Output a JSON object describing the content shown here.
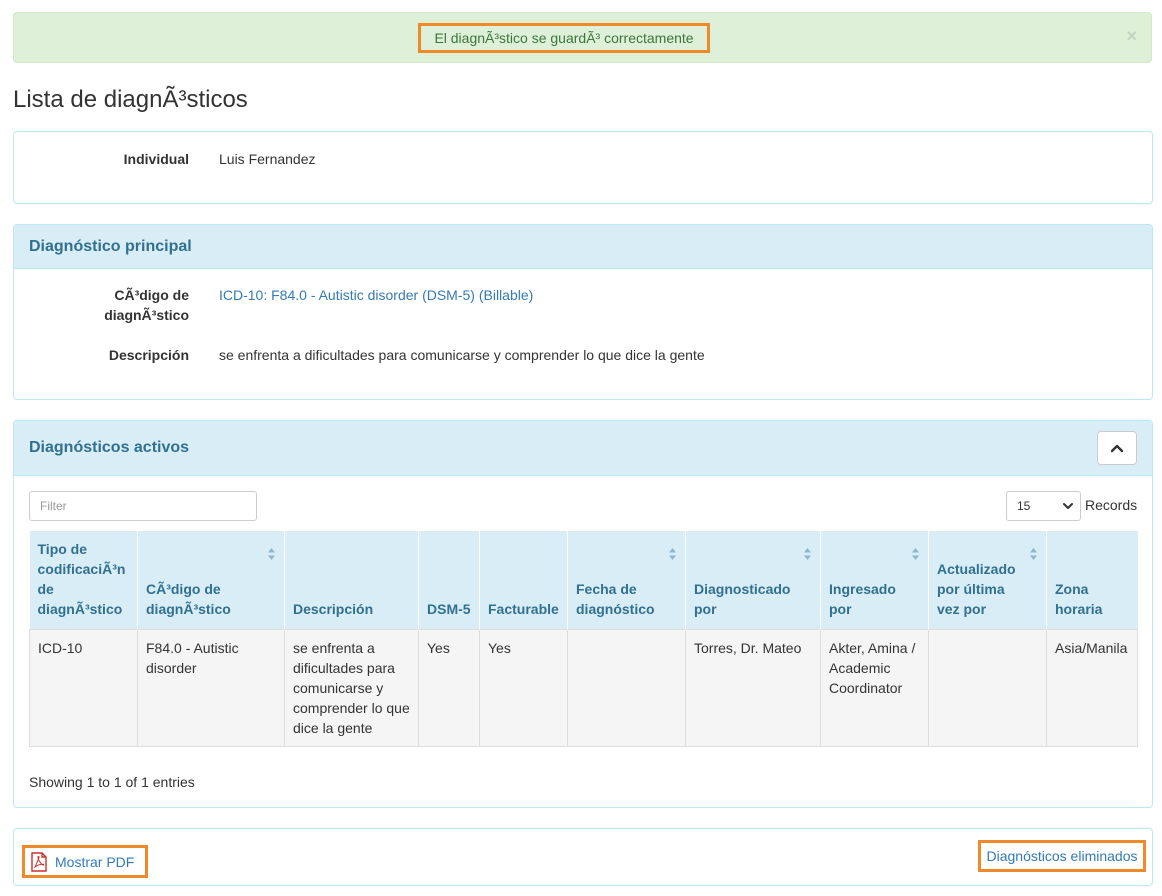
{
  "alert": {
    "message": "El diagnÃ³stico se guardÃ³ correctamente",
    "close_label": "×"
  },
  "page_title": "Lista de diagnÃ³sticos",
  "individual_panel": {
    "label": "Individual",
    "value": "Luis Fernandez"
  },
  "principal_panel": {
    "heading": "Diagnóstico principal",
    "code_label_line1": "CÃ³digo de",
    "code_label_line2": "diagnÃ³stico",
    "code_value": "ICD-10: F84.0 - Autistic disorder (DSM-5) (Billable)",
    "desc_label": "Descripción",
    "desc_value": "se enfrenta a dificultades para comunicarse y comprender lo que dice la gente"
  },
  "active_panel": {
    "heading": "Diagnósticos activos",
    "filter_placeholder": "Filter",
    "records_value": "15",
    "records_label": "Records",
    "columns": [
      {
        "l1": "Tipo de",
        "l2": "codificaciÃ³n",
        "l3": "de",
        "l4": "diagnÃ³stico",
        "sortable": false
      },
      {
        "l1": "CÃ³digo de",
        "l2": "diagnÃ³stico",
        "sortable": true
      },
      {
        "l1": "Descripción",
        "sortable": false
      },
      {
        "l1": "DSM-5",
        "sortable": false
      },
      {
        "l1": "Facturable",
        "sortable": false
      },
      {
        "l1": "Fecha de",
        "l2": "diagnóstico",
        "sortable": true
      },
      {
        "l1": "Diagnosticado",
        "l2": "por",
        "sortable": true
      },
      {
        "l1": "Ingresado",
        "l2": "por",
        "sortable": true
      },
      {
        "l1": "Actualizado",
        "l2": "por última",
        "l3": "vez por",
        "sortable": true
      },
      {
        "l1": "Zona",
        "l2": "horaria",
        "sortable": false
      }
    ],
    "rows": [
      {
        "tipo": "ICD-10",
        "codigo_l1": "F84.0 - Autistic",
        "codigo_l2": "disorder",
        "desc_l1": "se enfrenta a",
        "desc_l2": "dificultades para",
        "desc_l3": "comunicarse y",
        "desc_l4": "comprender lo que",
        "desc_l5": "dice la gente",
        "dsm5": "Yes",
        "facturable": "Yes",
        "fecha": "",
        "diagnosticado": "Torres, Dr. Mateo",
        "ingresado_l1": "Akter, Amina /",
        "ingresado_l2": "Academic",
        "ingresado_l3": "Coordinator",
        "actualizado": "",
        "zona": "Asia/Manila"
      }
    ],
    "showing_text": "Showing 1 to 1 of 1 entries"
  },
  "footer": {
    "pdf_label": "Mostrar PDF",
    "deleted_label": "Diagnósticos eliminados"
  },
  "colors": {
    "highlight": "#f0892a",
    "success_bg": "#dff0d8",
    "info_bg": "#d9edf7",
    "info_text": "#31708f",
    "link": "#337ab7"
  }
}
